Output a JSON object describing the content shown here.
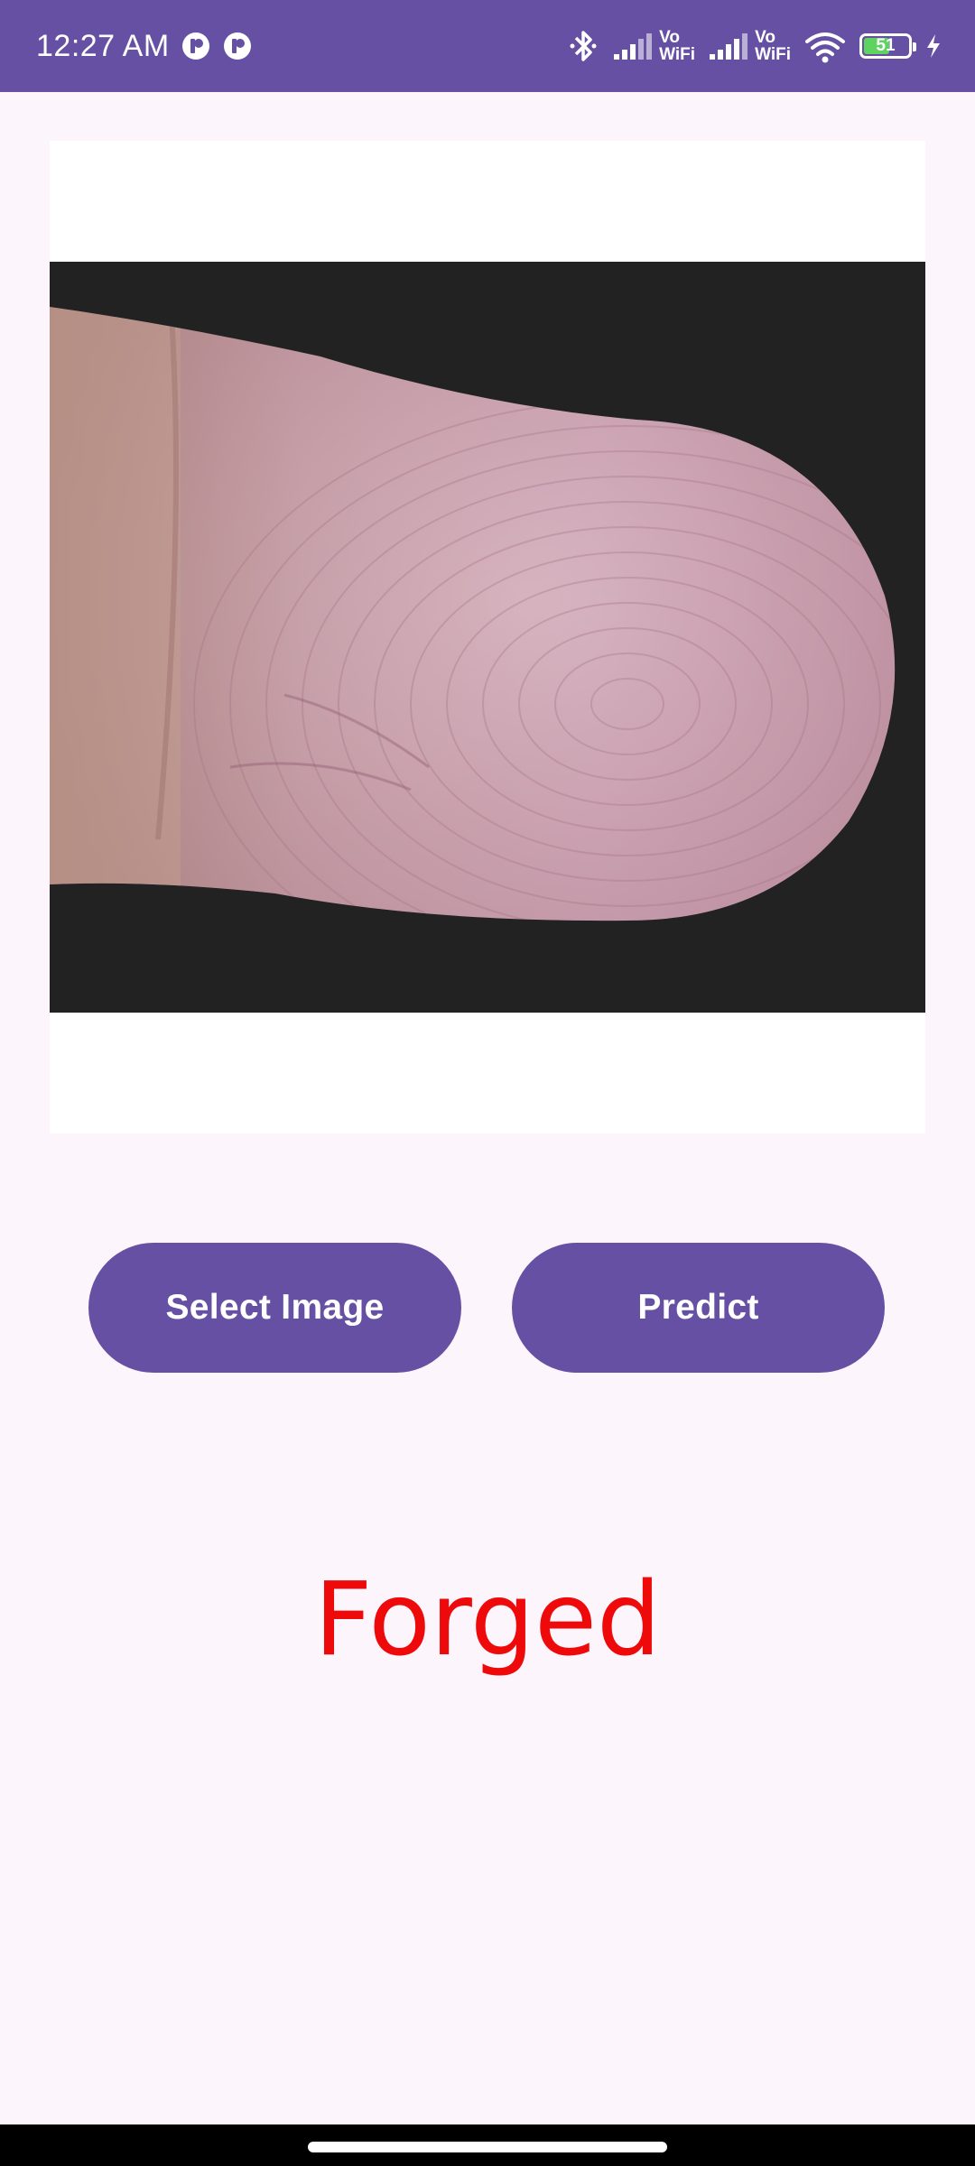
{
  "status_bar": {
    "time": "12:27 AM",
    "notification_icons": [
      "app-notification-icon",
      "app-notification-icon"
    ],
    "vowifi_top": "Vo",
    "vowifi_bottom": "WiFi",
    "battery_level": "51",
    "icons": [
      "bluetooth-icon",
      "signal-icon",
      "vowifi-icon",
      "signal-icon",
      "vowifi-icon",
      "wifi-icon",
      "battery-icon",
      "charging-icon"
    ]
  },
  "image_view": {
    "content": "fingerprint-photo"
  },
  "buttons": {
    "select_label": "Select Image",
    "predict_label": "Predict"
  },
  "result": {
    "text": "Forged",
    "color": "#ee0a0a"
  },
  "colors": {
    "primary": "#6650a4",
    "background": "#fcf6fc"
  }
}
